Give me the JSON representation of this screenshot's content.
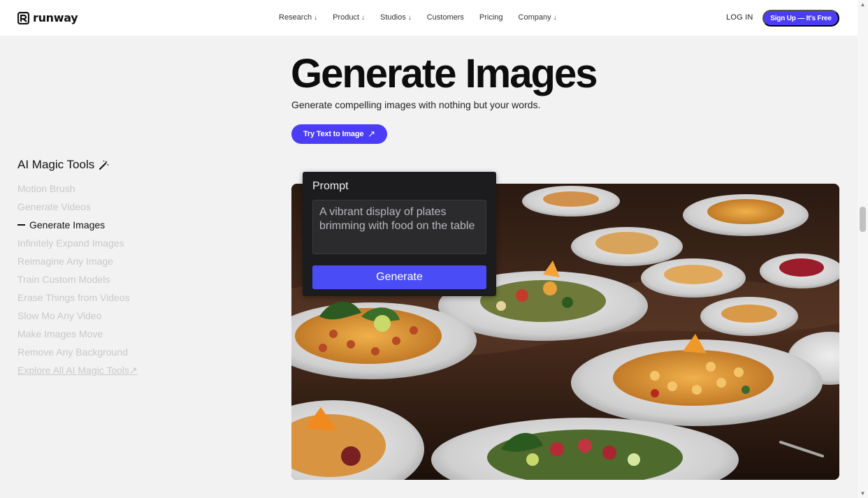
{
  "header": {
    "logo_text": "runway",
    "nav": [
      {
        "label": "Research",
        "arrow": "↓"
      },
      {
        "label": "Product",
        "arrow": "↓"
      },
      {
        "label": "Studios",
        "arrow": "↓"
      },
      {
        "label": "Customers",
        "arrow": ""
      },
      {
        "label": "Pricing",
        "arrow": ""
      },
      {
        "label": "Company",
        "arrow": "↓"
      }
    ],
    "login": "LOG IN",
    "signup": "Sign Up — It's Free"
  },
  "hero": {
    "title": "Generate Images",
    "subtitle": "Generate compelling images with nothing but your words.",
    "cta": "Try Text to Image",
    "cta_icon": "↗"
  },
  "sidebar": {
    "title": "AI Magic Tools",
    "items": [
      {
        "label": "Motion Brush"
      },
      {
        "label": "Generate Videos"
      },
      {
        "label": "Generate Images"
      },
      {
        "label": "Infinitely Expand Images"
      },
      {
        "label": "Reimagine Any Image"
      },
      {
        "label": "Train Custom Models"
      },
      {
        "label": "Erase Things from Videos"
      },
      {
        "label": "Slow Mo Any Video"
      },
      {
        "label": "Make Images Move"
      },
      {
        "label": "Remove Any Background"
      },
      {
        "label": "Explore All AI Magic Tools",
        "icon": "↗"
      }
    ]
  },
  "prompt": {
    "label": "Prompt",
    "text": "A vibrant display of plates brimming with food on the table",
    "button": "Generate"
  },
  "colors": {
    "accent": "#4a3df5",
    "background": "#f2f2f2",
    "card": "#1c1c1e",
    "muted_text": "#c9c9c9"
  }
}
